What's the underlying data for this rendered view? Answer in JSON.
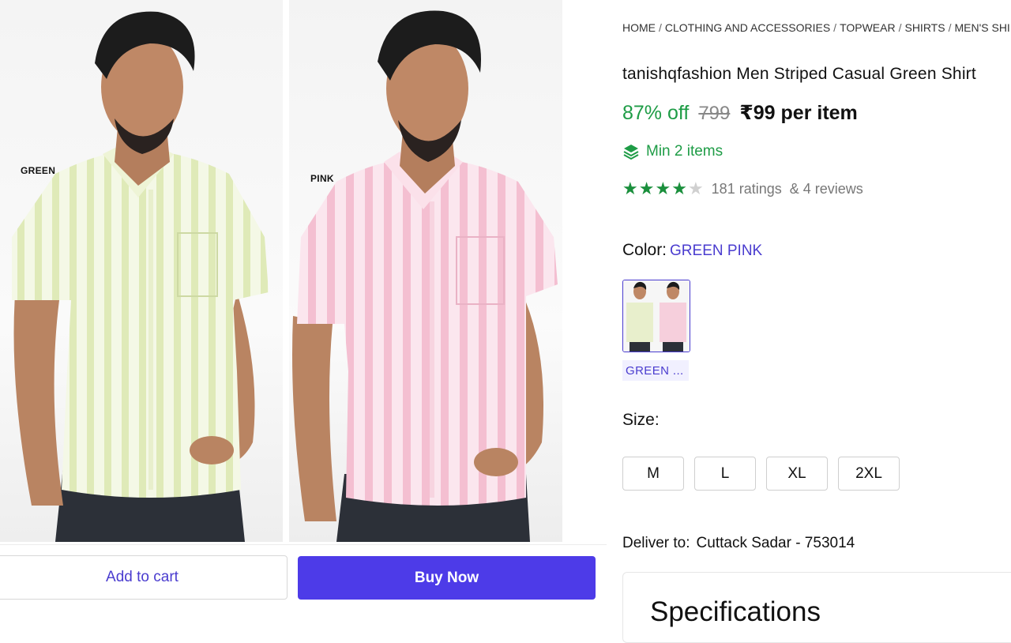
{
  "gallery": {
    "green_label": "GREEN",
    "pink_label": "PINK"
  },
  "actions": {
    "add_to_cart": "Add to cart",
    "buy_now": "Buy Now"
  },
  "breadcrumb": [
    "HOME",
    "CLOTHING AND ACCESSORIES",
    "TOPWEAR",
    "SHIRTS",
    "MEN'S SHIRTS"
  ],
  "product": {
    "title": "tanishqfashion Men Striped Casual Green Shirt",
    "discount": "87% off",
    "mrp": "799",
    "price": "₹99 per item",
    "min_items": "Min 2 items",
    "rating_stars": 4,
    "ratings": "181 ratings",
    "reviews": "& 4 reviews"
  },
  "color": {
    "label": "Color:",
    "value": "GREEN PINK",
    "swatch_label": "GREEN ..."
  },
  "size": {
    "label": "Size:",
    "options": [
      "M",
      "L",
      "XL",
      "2XL"
    ]
  },
  "delivery": {
    "label": "Deliver to:",
    "location": "Cuttack Sadar - 753014"
  },
  "specifications": {
    "title": "Specifications"
  },
  "colors": {
    "accent": "#4d3be8",
    "green": "#1e9c46",
    "star": "#1a8f3c"
  }
}
